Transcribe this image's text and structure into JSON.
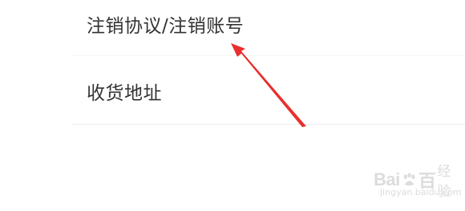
{
  "settings": {
    "items": [
      {
        "label": "注销协议/注销账号"
      },
      {
        "label": "收货地址"
      }
    ]
  },
  "annotation": {
    "arrow_color": "#e8302f"
  },
  "watermark": {
    "brand": "Bai",
    "brand_suffix": "百",
    "product": "经验",
    "url": "jingyan.baidu.com"
  }
}
